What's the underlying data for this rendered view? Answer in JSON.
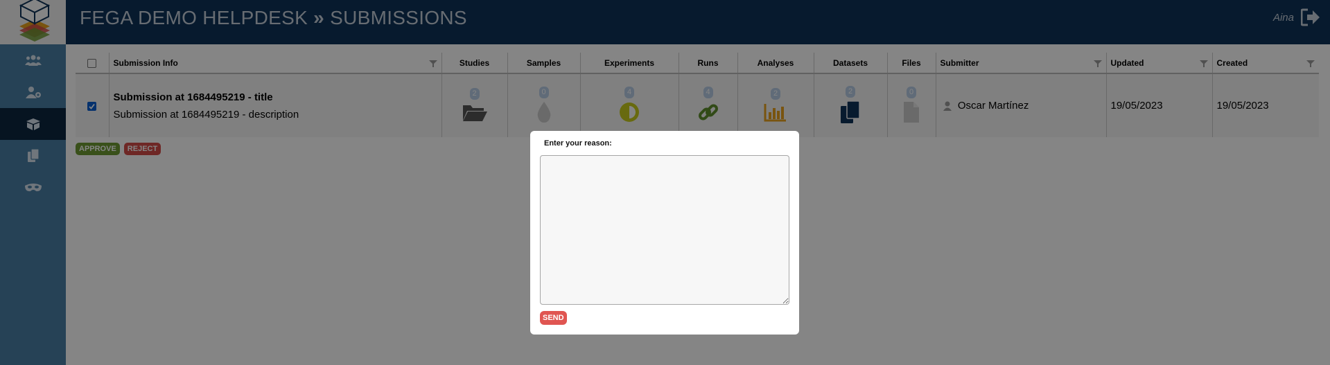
{
  "header": {
    "title": "FEGA DEMO HELPDESK",
    "separator": "»",
    "section": "SUBMISSIONS",
    "user": "Aina"
  },
  "sidebar": {
    "items": [
      {
        "icon": "users-icon"
      },
      {
        "icon": "user-settings-icon"
      },
      {
        "icon": "box-icon",
        "active": true
      },
      {
        "icon": "copy-icon"
      },
      {
        "icon": "mask-icon"
      }
    ]
  },
  "table": {
    "columns": [
      "Submission Info",
      "Studies",
      "Samples",
      "Experiments",
      "Runs",
      "Analyses",
      "Datasets",
      "Files",
      "Submitter",
      "Updated",
      "Created"
    ],
    "rows": [
      {
        "checked": true,
        "title": "Submission at 1684495219 - title",
        "description": "Submission at 1684495219 - description",
        "counts": {
          "studies": "2",
          "samples": "0",
          "experiments": "4",
          "runs": "4",
          "analyses": "2",
          "datasets": "2",
          "files": "0"
        },
        "submitter": "Oscar Martínez",
        "updated": "19/05/2023",
        "created": "19/05/2023"
      }
    ]
  },
  "actions": {
    "approve": "APPROVE",
    "reject": "REJECT"
  },
  "modal": {
    "label": "Enter your reason:",
    "textarea_value": "",
    "send": "SEND"
  },
  "colors": {
    "header_bg": "#0f3358",
    "sidebar_bg": "#4a7fa5",
    "sidebar_active": "#0d2740",
    "approve": "#6d9a33",
    "reject": "#d34b48",
    "studies_icon": "#555555",
    "samples_icon": "#cccccc",
    "experiments_icon": "#c8cc1e",
    "runs_icon": "#5f8e2c",
    "analyses_icon": "#e8a21d",
    "datasets_icon": "#0f3358",
    "files_icon": "#cccccc"
  }
}
